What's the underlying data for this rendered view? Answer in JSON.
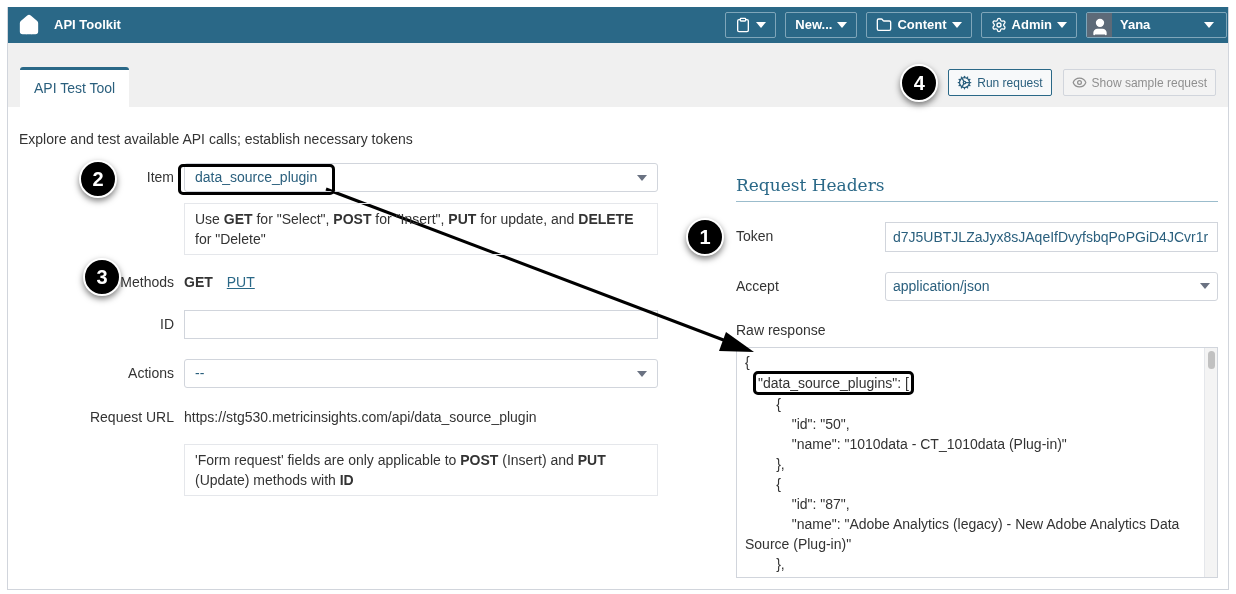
{
  "header": {
    "title": "API Toolkit",
    "menus": [
      {
        "kind": "clipboard"
      },
      {
        "kind": "text",
        "label": "New..."
      },
      {
        "kind": "folder",
        "label": "Content"
      },
      {
        "kind": "gear",
        "label": "Admin"
      }
    ],
    "user": "Yana"
  },
  "tabs": [
    {
      "label": "API Test Tool",
      "selected": true
    }
  ],
  "toolbar": [
    {
      "kind": "gears",
      "label": "Run request",
      "disabled": false,
      "callout": "4"
    },
    {
      "kind": "eye",
      "label": "Show sample request",
      "disabled": true
    }
  ],
  "description": "Explore and test available API calls; establish necessary tokens",
  "form": {
    "item": {
      "label": "Item",
      "value": "data_source_plugin",
      "callout": "2"
    },
    "item_hint": "Use **GET** for \"Select\", **POST** for \"Insert\", **PUT** for update, and **DELETE** for \"Delete\"",
    "methods": {
      "label": "Methods",
      "callout": "3",
      "options": [
        {
          "label": "GET",
          "selected": true
        },
        {
          "label": "PUT",
          "selected": false
        }
      ]
    },
    "id": {
      "label": "ID"
    },
    "actions": {
      "label": "Actions",
      "value": "--"
    },
    "request_url": {
      "label": "Request URL",
      "value": "https://stg530.metricinsights.com/api/data_source_plugin"
    },
    "note": "'Form request' fields are only applicable to **POST** (Insert) and **PUT** (Update) methods with **ID**"
  },
  "request_headers": {
    "title": "Request Headers",
    "token": {
      "label": "Token",
      "value": "d7J5UBTJLZaJyx8sJAqeIfDvyfsbqPoPGiD4JCvr1r",
      "callout": "1"
    },
    "accept": {
      "label": "Accept",
      "value": "application/json"
    },
    "raw_response": {
      "label": "Raw response",
      "lines": [
        {
          "text": "{",
          "highlighted": false
        },
        {
          "text": "\"data_source_plugins\": [",
          "highlighted": true
        },
        {
          "text": "        {",
          "highlighted": false
        },
        {
          "text": "            \"id\": \"50\",",
          "highlighted": false
        },
        {
          "text": "            \"name\": \"1010data - CT_1010data (Plug-in)\"",
          "highlighted": false
        },
        {
          "text": "        },",
          "highlighted": false
        },
        {
          "text": "        {",
          "highlighted": false
        },
        {
          "text": "            \"id\": \"87\",",
          "highlighted": false
        },
        {
          "text": "            \"name\": \"Adobe Analytics (legacy) - New Adobe Analytics Data Source (Plug-in)\"",
          "highlighted": false
        },
        {
          "text": "        },",
          "highlighted": false
        }
      ]
    }
  }
}
